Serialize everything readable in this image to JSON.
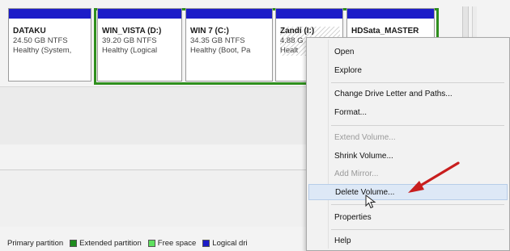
{
  "partitions": [
    {
      "name": "DATAKU",
      "size": "24.50 GB NTFS",
      "status": "Healthy (System,"
    },
    {
      "name": "WIN_VISTA  (D:)",
      "size": "39.20 GB NTFS",
      "status": "Healthy (Logical"
    },
    {
      "name": "WIN 7  (C:)",
      "size": "34.35 GB NTFS",
      "status": "Healthy (Boot, Pa"
    },
    {
      "name": "Zandi  (I:)",
      "size": "4.88 G",
      "status": "Healt"
    },
    {
      "name": "HDSata_MASTER",
      "size": "",
      "status": ""
    }
  ],
  "legend": [
    {
      "label": "Primary partition",
      "color": ""
    },
    {
      "label": "Extended partition",
      "color": "#1e8c1e"
    },
    {
      "label": "Free space",
      "color": "#5ee05e"
    },
    {
      "label": "Logical dri",
      "color": "#1c1cc8"
    }
  ],
  "context_menu": {
    "items": [
      {
        "label": "Open",
        "enabled": true
      },
      {
        "label": "Explore",
        "enabled": true
      },
      {
        "label": "Change Drive Letter and Paths...",
        "enabled": true
      },
      {
        "label": "Format...",
        "enabled": true
      },
      {
        "label": "Extend Volume...",
        "enabled": false
      },
      {
        "label": "Shrink Volume...",
        "enabled": true
      },
      {
        "label": "Add Mirror...",
        "enabled": false
      },
      {
        "label": "Delete Volume...",
        "enabled": true,
        "hovered": true
      },
      {
        "label": "Properties",
        "enabled": true
      },
      {
        "label": "Help",
        "enabled": true
      }
    ]
  },
  "colors": {
    "partition_bar": "#1c1cc8",
    "extended_border": "#2f8f1e",
    "annotation_arrow": "#c81e1e"
  }
}
